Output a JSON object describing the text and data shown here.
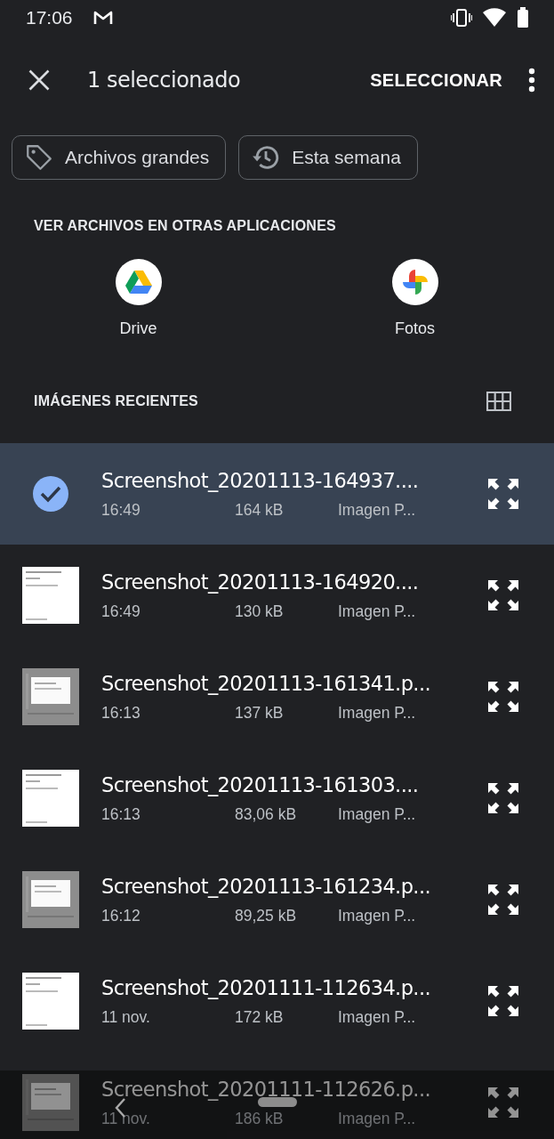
{
  "status_bar": {
    "time": "17:06"
  },
  "app_bar": {
    "title": "1 seleccionado",
    "action": "SELECCIONAR"
  },
  "chips": [
    {
      "label": "Archivos grandes"
    },
    {
      "label": "Esta semana"
    }
  ],
  "other_apps": {
    "heading": "VER ARCHIVOS EN OTRAS APLICACIONES",
    "apps": [
      {
        "label": "Drive"
      },
      {
        "label": "Fotos"
      }
    ]
  },
  "recent": {
    "heading": "IMÁGENES RECIENTES",
    "files": [
      {
        "name": "Screenshot_20201113-164937....",
        "date": "16:49",
        "size": "164 kB",
        "type": "Imagen P...",
        "selected": true
      },
      {
        "name": "Screenshot_20201113-164920....",
        "date": "16:49",
        "size": "130 kB",
        "type": "Imagen P...",
        "selected": false
      },
      {
        "name": "Screenshot_20201113-161341.p...",
        "date": "16:13",
        "size": "137 kB",
        "type": "Imagen P...",
        "selected": false
      },
      {
        "name": "Screenshot_20201113-161303....",
        "date": "16:13",
        "size": "83,06 kB",
        "type": "Imagen P...",
        "selected": false
      },
      {
        "name": "Screenshot_20201113-161234.p...",
        "date": "16:12",
        "size": "89,25 kB",
        "type": "Imagen P...",
        "selected": false
      },
      {
        "name": "Screenshot_20201111-112634.p...",
        "date": "11 nov.",
        "size": "172 kB",
        "type": "Imagen P...",
        "selected": false
      },
      {
        "name": "Screenshot_20201111-112626.p...",
        "date": "11 nov.",
        "size": "186 kB",
        "type": "Imagen P...",
        "selected": false
      }
    ]
  }
}
